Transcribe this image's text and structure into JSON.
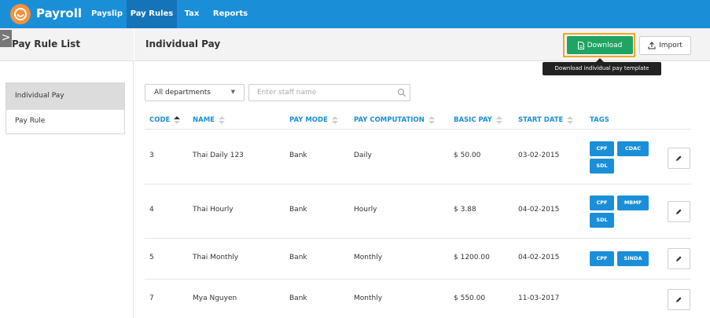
{
  "app": {
    "name": "Payroll",
    "nav": [
      "Payslip",
      "Pay Rules",
      "Tax",
      "Reports"
    ],
    "active_nav": "Pay Rules"
  },
  "sidebar": {
    "title": "Pay Rule List",
    "collapse_glyph": ">",
    "items": [
      "Individual Pay",
      "Pay Rule"
    ],
    "active_item": "Individual Pay"
  },
  "main": {
    "title": "Individual Pay",
    "download_label": "Download",
    "import_label": "Import",
    "tooltip": "Download individual pay template"
  },
  "filters": {
    "department_value": "All departments",
    "staff_placeholder": "Enter staff name"
  },
  "table": {
    "columns": [
      "CODE",
      "NAME",
      "PAY MODE",
      "PAY COMPUTATION",
      "BASIC PAY",
      "START DATE",
      "TAGS"
    ],
    "sorted_column": "CODE",
    "rows": [
      {
        "code": "3",
        "name": "Thai Daily 123",
        "pay_mode": "Bank",
        "pay_computation": "Daily",
        "basic_pay": "$ 50.00",
        "start_date": "03-02-2015",
        "tags": [
          "CPF",
          "CDAC",
          "SDL"
        ]
      },
      {
        "code": "4",
        "name": "Thai Hourly",
        "pay_mode": "Bank",
        "pay_computation": "Hourly",
        "basic_pay": "$ 3.88",
        "start_date": "04-02-2015",
        "tags": [
          "CPF",
          "MBMF",
          "SDL"
        ]
      },
      {
        "code": "5",
        "name": "Thai Monthly",
        "pay_mode": "Bank",
        "pay_computation": "Monthly",
        "basic_pay": "$ 1200.00",
        "start_date": "04-02-2015",
        "tags": [
          "CPF",
          "SINDA"
        ]
      },
      {
        "code": "7",
        "name": "Mya Nguyen",
        "pay_mode": "Bank",
        "pay_computation": "Monthly",
        "basic_pay": "$ 550.00",
        "start_date": "11-03-2017",
        "tags": []
      }
    ]
  },
  "colors": {
    "primary": "#1a8fd8",
    "nav_active": "#1574b8",
    "download_green": "#1fa463",
    "highlight_orange": "#f5a623",
    "logo_orange": "#f5913b"
  },
  "icons": {
    "logo": "smiley-clock-icon",
    "download": "file-icon",
    "import": "upload-icon",
    "search": "search-icon",
    "edit": "pencil-icon",
    "sort": "sort-arrows-icon",
    "dropdown": "caret-down-icon"
  }
}
